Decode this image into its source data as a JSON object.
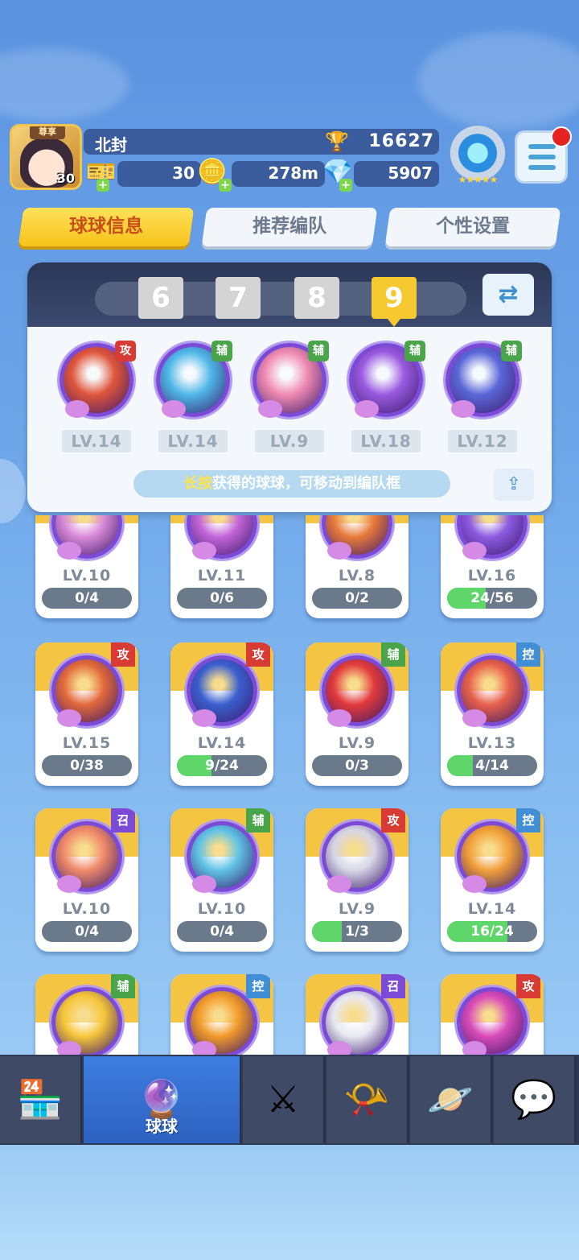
{
  "player": {
    "vip_label": "尊享",
    "avatar_level": "30",
    "name": "北封",
    "trophies": "16627",
    "tickets": "30",
    "distance": "278m",
    "gems": "5907"
  },
  "tabs": [
    {
      "label": "球球信息",
      "active": true
    },
    {
      "label": "推荐编队",
      "active": false
    },
    {
      "label": "个性设置",
      "active": false
    }
  ],
  "team": {
    "numbers": [
      "6",
      "7",
      "8",
      "9"
    ],
    "selected": "9",
    "balls": [
      {
        "tag": "攻",
        "tag_type": "atk",
        "level": "LV.14",
        "color": "#e0553a"
      },
      {
        "tag": "辅",
        "tag_type": "sup",
        "level": "LV.14",
        "color": "#4fb8e8"
      },
      {
        "tag": "辅",
        "tag_type": "sup",
        "level": "LV.9",
        "color": "#f08bb2"
      },
      {
        "tag": "辅",
        "tag_type": "sup",
        "level": "LV.18",
        "color": "#9a5ae0"
      },
      {
        "tag": "辅",
        "tag_type": "sup",
        "level": "LV.12",
        "color": "#5b67d8"
      }
    ],
    "hint_highlight": "长按",
    "hint_text": "获得的球球，可移动到编队框"
  },
  "cards": [
    {
      "level": "LV.10",
      "progress": "0/4",
      "fill": 0,
      "tag": "",
      "tag_type": "",
      "color": "#d98ad8"
    },
    {
      "level": "LV.11",
      "progress": "0/6",
      "fill": 0,
      "tag": "",
      "tag_type": "",
      "color": "#c264d8"
    },
    {
      "level": "LV.8",
      "progress": "0/2",
      "fill": 0,
      "tag": "",
      "tag_type": "",
      "color": "#e87a3a"
    },
    {
      "level": "LV.16",
      "progress": "24/56",
      "fill": 0.43,
      "tag": "",
      "tag_type": "",
      "color": "#8c5ae0"
    },
    {
      "level": "LV.15",
      "progress": "0/38",
      "fill": 0,
      "tag": "攻",
      "tag_type": "atk",
      "color": "#e2693a"
    },
    {
      "level": "LV.14",
      "progress": "9/24",
      "fill": 0.38,
      "tag": "攻",
      "tag_type": "atk",
      "color": "#3a5fcf"
    },
    {
      "level": "LV.9",
      "progress": "0/3",
      "fill": 0,
      "tag": "辅",
      "tag_type": "sup",
      "color": "#e23a3a"
    },
    {
      "level": "LV.13",
      "progress": "4/14",
      "fill": 0.29,
      "tag": "控",
      "tag_type": "ctl",
      "color": "#e8604a"
    },
    {
      "level": "LV.10",
      "progress": "0/4",
      "fill": 0,
      "tag": "召",
      "tag_type": "sum",
      "color": "#f08a6a"
    },
    {
      "level": "LV.10",
      "progress": "0/4",
      "fill": 0,
      "tag": "辅",
      "tag_type": "sup",
      "color": "#5fc3e6"
    },
    {
      "level": "LV.9",
      "progress": "1/3",
      "fill": 0.33,
      "tag": "攻",
      "tag_type": "atk",
      "color": "#d6d6e6"
    },
    {
      "level": "LV.14",
      "progress": "16/24",
      "fill": 0.67,
      "tag": "控",
      "tag_type": "ctl",
      "color": "#f2a03a"
    },
    {
      "level": "",
      "progress": "",
      "fill": 0,
      "tag": "辅",
      "tag_type": "sup",
      "color": "#f6c63a"
    },
    {
      "level": "",
      "progress": "",
      "fill": 0,
      "tag": "控",
      "tag_type": "ctl",
      "color": "#f29a2a"
    },
    {
      "level": "",
      "progress": "",
      "fill": 0,
      "tag": "召",
      "tag_type": "sum",
      "color": "#e8e8f2"
    },
    {
      "level": "",
      "progress": "",
      "fill": 0,
      "tag": "攻",
      "tag_type": "atk",
      "color": "#d84ab8"
    }
  ],
  "nav": [
    {
      "name": "shop",
      "icon": "shop-icon",
      "glyph": "🏪",
      "label": "",
      "active": false
    },
    {
      "name": "balls",
      "icon": "balls-icon",
      "glyph": "🔮",
      "label": "球球",
      "active": true
    },
    {
      "name": "battle",
      "icon": "crossed-swords-icon",
      "glyph": "⚔",
      "label": "",
      "active": false
    },
    {
      "name": "whistle",
      "icon": "whistle-icon",
      "glyph": "📯",
      "label": "",
      "active": false
    },
    {
      "name": "planet",
      "icon": "planet-icon",
      "glyph": "🪐",
      "label": "",
      "active": false
    },
    {
      "name": "social",
      "icon": "chat-heart-icon",
      "glyph": "💬",
      "label": "",
      "active": false
    }
  ]
}
